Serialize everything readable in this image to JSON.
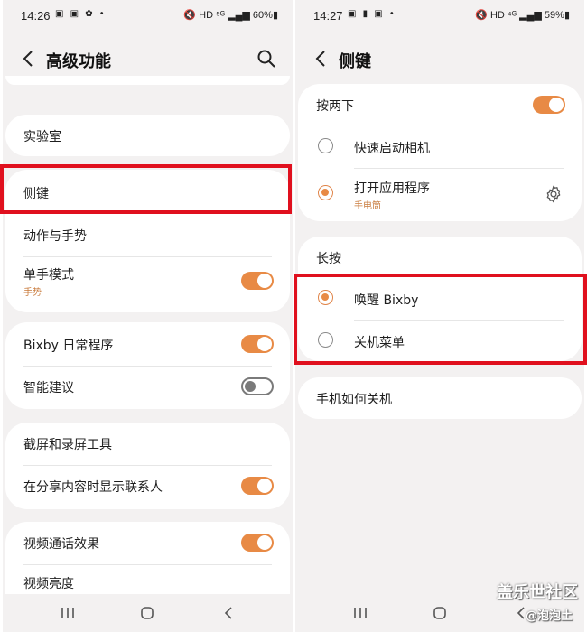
{
  "left": {
    "status": {
      "time": "14:26",
      "icons_left": "▣ ▣ ✿ •",
      "icons_right": "🔇 HD ⁵ᴳ ▂▄▆ 60%▮"
    },
    "title": "高级功能",
    "top_clip_label": "",
    "items": {
      "lab": "实验室",
      "side_key": "侧键",
      "motions": "动作与手势",
      "one_hand": "单手模式",
      "one_hand_sub": "手势",
      "bixby_routines": "Bixby 日常程序",
      "smart_suggestions": "智能建议",
      "screenshot_tools": "截屏和录屏工具",
      "share_contacts": "在分享内容时显示联系人",
      "video_call_effects": "视频通话效果",
      "video_brightness": "视频亮度"
    }
  },
  "right": {
    "status": {
      "time": "14:27",
      "icons_left": "▣ ▮ ▣ •",
      "icons_right": "🔇 HD ⁴ᴳ ▂▄▆ 59%▮"
    },
    "title": "侧键",
    "double_press": {
      "label": "按两下",
      "option_camera": "快速启动相机",
      "option_app": "打开应用程序",
      "option_app_sub": "手电筒"
    },
    "long_press": {
      "label": "长按",
      "option_bixby": "唤醒 Bixby",
      "option_power_menu": "关机菜单"
    },
    "how_to_power_off": "手机如何关机"
  },
  "watermark": {
    "line1": "盖乐世社区",
    "line2": "@泡泡土"
  },
  "colors": {
    "accent": "#e88a45",
    "highlight_box": "#e0101e",
    "background": "#f3f1f1"
  }
}
